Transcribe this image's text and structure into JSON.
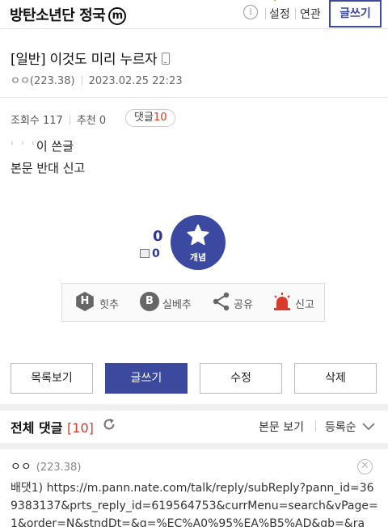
{
  "header": {
    "gallery_title": "방탄소년단 정국",
    "minor_badge": "m",
    "info_icon": "i",
    "settings_label": "설정",
    "related_label": "연관",
    "write_label": "글쓰기"
  },
  "post": {
    "title": "[일반] 이것도 미리 누르자",
    "author": "ㅇㅇ(223.38)",
    "datetime": "2023.02.25 22:23",
    "views_label": "조회수 117",
    "recommend_label": "추천 0",
    "reply_label": "댓글",
    "reply_count": "10",
    "body_line1_prefix": "'  ' '",
    "body_line1": "이 쓴글",
    "body_line2": "본문 반대 신고"
  },
  "vote": {
    "up_count": "0",
    "fixed_count": "0",
    "button_label": "개념"
  },
  "share": {
    "hit_icon": "H",
    "hit_label": "힛추",
    "best_icon": "B",
    "best_label": "실베추",
    "share_label": "공유",
    "report_label": "신고"
  },
  "actions": {
    "list_label": "목록보기",
    "write_label": "글쓰기",
    "edit_label": "수정",
    "delete_label": "삭제"
  },
  "comments": {
    "heading": "전체 댓글",
    "count": "[10]",
    "body_view_label": "본문 보기",
    "sort_label": "등록순",
    "items": [
      {
        "author": "ㅇㅇ",
        "ip": "(223.38)",
        "text": "배댓1) https://m.pann.nate.com/talk/reply/subReply?pann_id=369383137&prts_reply_id=619564753&currMenu=search&vPage=1&order=N&stndDt=&q=%EC%A0%95%EA%B5%AD&gb=&ra"
      }
    ]
  },
  "colors": {
    "accent": "#3c4a9e",
    "alert_red": "#d93a2c"
  }
}
